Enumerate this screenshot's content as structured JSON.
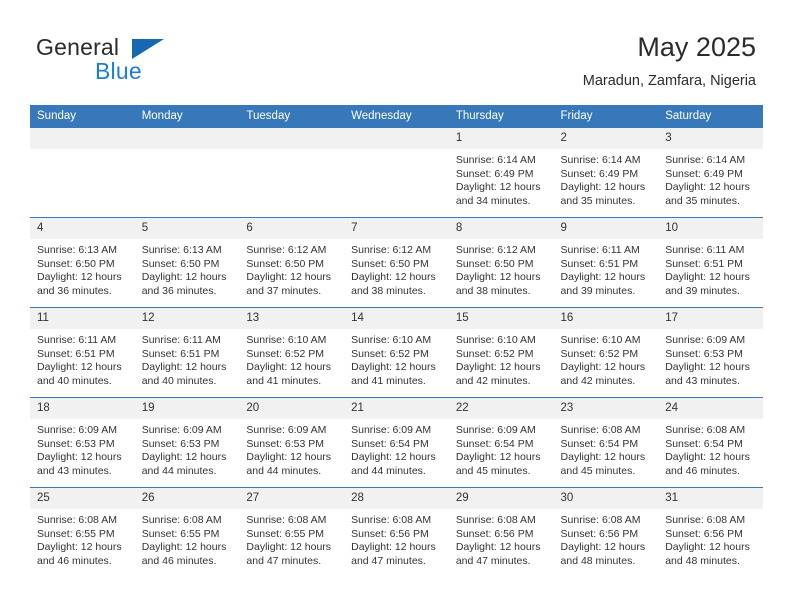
{
  "brand": {
    "name_part1": "General",
    "name_part2": "Blue",
    "accent_color": "#1668b3",
    "blue_text_color": "#1b7fd4"
  },
  "header": {
    "title": "May 2025",
    "location": "Maradun, Zamfara, Nigeria",
    "header_bg_color": "#3778bb",
    "daynum_bg_color": "#f1f1f1"
  },
  "weekdays": [
    "Sunday",
    "Monday",
    "Tuesday",
    "Wednesday",
    "Thursday",
    "Friday",
    "Saturday"
  ],
  "weeks": [
    [
      {
        "day": "",
        "empty": true
      },
      {
        "day": "",
        "empty": true
      },
      {
        "day": "",
        "empty": true
      },
      {
        "day": "",
        "empty": true
      },
      {
        "day": "1",
        "sunrise": "Sunrise: 6:14 AM",
        "sunset": "Sunset: 6:49 PM",
        "daylight1": "Daylight: 12 hours",
        "daylight2": "and 34 minutes."
      },
      {
        "day": "2",
        "sunrise": "Sunrise: 6:14 AM",
        "sunset": "Sunset: 6:49 PM",
        "daylight1": "Daylight: 12 hours",
        "daylight2": "and 35 minutes."
      },
      {
        "day": "3",
        "sunrise": "Sunrise: 6:14 AM",
        "sunset": "Sunset: 6:49 PM",
        "daylight1": "Daylight: 12 hours",
        "daylight2": "and 35 minutes."
      }
    ],
    [
      {
        "day": "4",
        "sunrise": "Sunrise: 6:13 AM",
        "sunset": "Sunset: 6:50 PM",
        "daylight1": "Daylight: 12 hours",
        "daylight2": "and 36 minutes."
      },
      {
        "day": "5",
        "sunrise": "Sunrise: 6:13 AM",
        "sunset": "Sunset: 6:50 PM",
        "daylight1": "Daylight: 12 hours",
        "daylight2": "and 36 minutes."
      },
      {
        "day": "6",
        "sunrise": "Sunrise: 6:12 AM",
        "sunset": "Sunset: 6:50 PM",
        "daylight1": "Daylight: 12 hours",
        "daylight2": "and 37 minutes."
      },
      {
        "day": "7",
        "sunrise": "Sunrise: 6:12 AM",
        "sunset": "Sunset: 6:50 PM",
        "daylight1": "Daylight: 12 hours",
        "daylight2": "and 38 minutes."
      },
      {
        "day": "8",
        "sunrise": "Sunrise: 6:12 AM",
        "sunset": "Sunset: 6:50 PM",
        "daylight1": "Daylight: 12 hours",
        "daylight2": "and 38 minutes."
      },
      {
        "day": "9",
        "sunrise": "Sunrise: 6:11 AM",
        "sunset": "Sunset: 6:51 PM",
        "daylight1": "Daylight: 12 hours",
        "daylight2": "and 39 minutes."
      },
      {
        "day": "10",
        "sunrise": "Sunrise: 6:11 AM",
        "sunset": "Sunset: 6:51 PM",
        "daylight1": "Daylight: 12 hours",
        "daylight2": "and 39 minutes."
      }
    ],
    [
      {
        "day": "11",
        "sunrise": "Sunrise: 6:11 AM",
        "sunset": "Sunset: 6:51 PM",
        "daylight1": "Daylight: 12 hours",
        "daylight2": "and 40 minutes."
      },
      {
        "day": "12",
        "sunrise": "Sunrise: 6:11 AM",
        "sunset": "Sunset: 6:51 PM",
        "daylight1": "Daylight: 12 hours",
        "daylight2": "and 40 minutes."
      },
      {
        "day": "13",
        "sunrise": "Sunrise: 6:10 AM",
        "sunset": "Sunset: 6:52 PM",
        "daylight1": "Daylight: 12 hours",
        "daylight2": "and 41 minutes."
      },
      {
        "day": "14",
        "sunrise": "Sunrise: 6:10 AM",
        "sunset": "Sunset: 6:52 PM",
        "daylight1": "Daylight: 12 hours",
        "daylight2": "and 41 minutes."
      },
      {
        "day": "15",
        "sunrise": "Sunrise: 6:10 AM",
        "sunset": "Sunset: 6:52 PM",
        "daylight1": "Daylight: 12 hours",
        "daylight2": "and 42 minutes."
      },
      {
        "day": "16",
        "sunrise": "Sunrise: 6:10 AM",
        "sunset": "Sunset: 6:52 PM",
        "daylight1": "Daylight: 12 hours",
        "daylight2": "and 42 minutes."
      },
      {
        "day": "17",
        "sunrise": "Sunrise: 6:09 AM",
        "sunset": "Sunset: 6:53 PM",
        "daylight1": "Daylight: 12 hours",
        "daylight2": "and 43 minutes."
      }
    ],
    [
      {
        "day": "18",
        "sunrise": "Sunrise: 6:09 AM",
        "sunset": "Sunset: 6:53 PM",
        "daylight1": "Daylight: 12 hours",
        "daylight2": "and 43 minutes."
      },
      {
        "day": "19",
        "sunrise": "Sunrise: 6:09 AM",
        "sunset": "Sunset: 6:53 PM",
        "daylight1": "Daylight: 12 hours",
        "daylight2": "and 44 minutes."
      },
      {
        "day": "20",
        "sunrise": "Sunrise: 6:09 AM",
        "sunset": "Sunset: 6:53 PM",
        "daylight1": "Daylight: 12 hours",
        "daylight2": "and 44 minutes."
      },
      {
        "day": "21",
        "sunrise": "Sunrise: 6:09 AM",
        "sunset": "Sunset: 6:54 PM",
        "daylight1": "Daylight: 12 hours",
        "daylight2": "and 44 minutes."
      },
      {
        "day": "22",
        "sunrise": "Sunrise: 6:09 AM",
        "sunset": "Sunset: 6:54 PM",
        "daylight1": "Daylight: 12 hours",
        "daylight2": "and 45 minutes."
      },
      {
        "day": "23",
        "sunrise": "Sunrise: 6:08 AM",
        "sunset": "Sunset: 6:54 PM",
        "daylight1": "Daylight: 12 hours",
        "daylight2": "and 45 minutes."
      },
      {
        "day": "24",
        "sunrise": "Sunrise: 6:08 AM",
        "sunset": "Sunset: 6:54 PM",
        "daylight1": "Daylight: 12 hours",
        "daylight2": "and 46 minutes."
      }
    ],
    [
      {
        "day": "25",
        "sunrise": "Sunrise: 6:08 AM",
        "sunset": "Sunset: 6:55 PM",
        "daylight1": "Daylight: 12 hours",
        "daylight2": "and 46 minutes."
      },
      {
        "day": "26",
        "sunrise": "Sunrise: 6:08 AM",
        "sunset": "Sunset: 6:55 PM",
        "daylight1": "Daylight: 12 hours",
        "daylight2": "and 46 minutes."
      },
      {
        "day": "27",
        "sunrise": "Sunrise: 6:08 AM",
        "sunset": "Sunset: 6:55 PM",
        "daylight1": "Daylight: 12 hours",
        "daylight2": "and 47 minutes."
      },
      {
        "day": "28",
        "sunrise": "Sunrise: 6:08 AM",
        "sunset": "Sunset: 6:56 PM",
        "daylight1": "Daylight: 12 hours",
        "daylight2": "and 47 minutes."
      },
      {
        "day": "29",
        "sunrise": "Sunrise: 6:08 AM",
        "sunset": "Sunset: 6:56 PM",
        "daylight1": "Daylight: 12 hours",
        "daylight2": "and 47 minutes."
      },
      {
        "day": "30",
        "sunrise": "Sunrise: 6:08 AM",
        "sunset": "Sunset: 6:56 PM",
        "daylight1": "Daylight: 12 hours",
        "daylight2": "and 48 minutes."
      },
      {
        "day": "31",
        "sunrise": "Sunrise: 6:08 AM",
        "sunset": "Sunset: 6:56 PM",
        "daylight1": "Daylight: 12 hours",
        "daylight2": "and 48 minutes."
      }
    ]
  ]
}
